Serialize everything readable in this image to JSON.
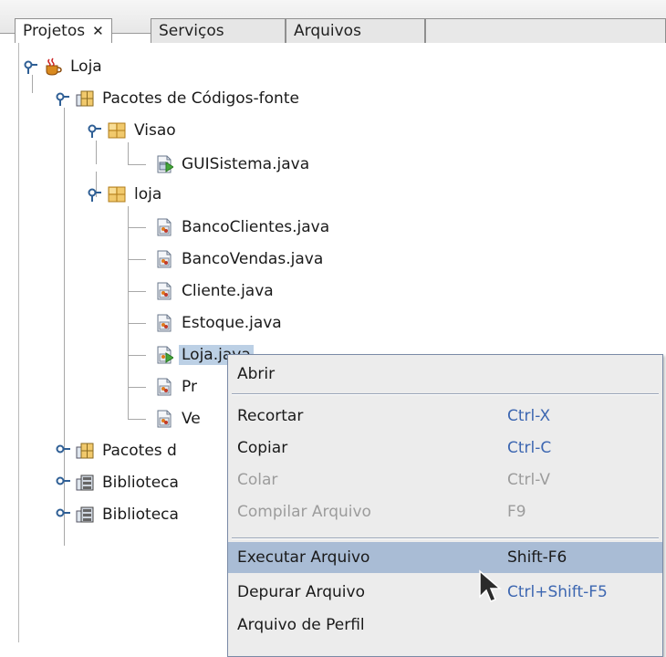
{
  "tabs": [
    {
      "label": "Projetos",
      "closable": true,
      "active": true
    },
    {
      "label": "Serviços",
      "active": false
    },
    {
      "label": "Arquivos",
      "active": false
    }
  ],
  "tree": {
    "project": "Loja",
    "source_packages": "Pacotes de Códigos-fonte",
    "package_visao": "Visao",
    "file_guisistema": "GUISistema.java",
    "package_loja": "loja",
    "files": [
      "BancoClientes.java",
      "BancoVendas.java",
      "Cliente.java",
      "Estoque.java",
      "Loja.java",
      "Pr",
      "Ve"
    ],
    "collapsed": [
      "Pacotes d",
      "Biblioteca",
      "Biblioteca"
    ]
  },
  "context_menu": {
    "items": [
      {
        "label": "Abrir",
        "shortcut": "",
        "disabled": false
      },
      {
        "label": "Recortar",
        "shortcut": "Ctrl-X",
        "disabled": false
      },
      {
        "label": "Copiar",
        "shortcut": "Ctrl-C",
        "disabled": false
      },
      {
        "label": "Colar",
        "shortcut": "Ctrl-V",
        "disabled": true
      },
      {
        "label": "Compilar Arquivo",
        "shortcut": "F9",
        "disabled": true
      },
      {
        "label": "Executar Arquivo",
        "shortcut": "Shift-F6",
        "disabled": false,
        "highlighted": true
      },
      {
        "label": "Depurar Arquivo",
        "shortcut": "Ctrl+Shift-F5",
        "disabled": false
      },
      {
        "label": "Arquivo de Perfil",
        "shortcut": "",
        "disabled": false
      }
    ]
  },
  "colors": {
    "selection": "#bcd0e5",
    "menu_highlight": "#a9bcd5",
    "shortcut_text": "#3d67b1"
  }
}
